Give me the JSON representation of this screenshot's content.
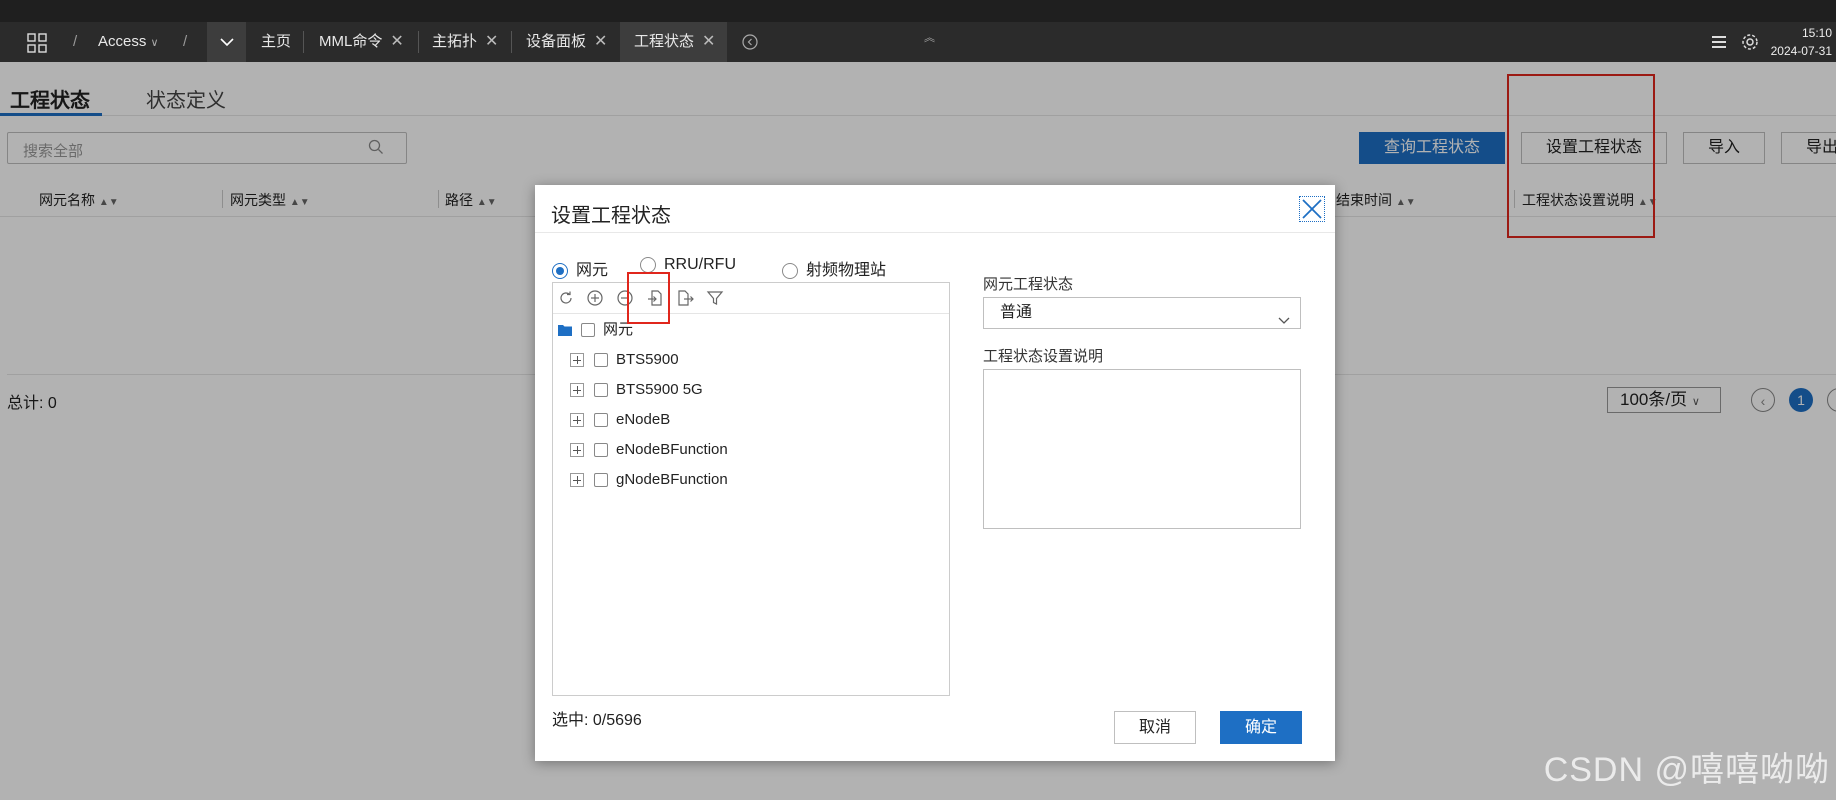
{
  "topbar": {
    "breadcrumb_app": "Access",
    "tabs": [
      {
        "label": "主页",
        "closable": false,
        "active": false
      },
      {
        "label": "MML命令",
        "closable": true,
        "active": false
      },
      {
        "label": "主拓扑",
        "closable": true,
        "active": false
      },
      {
        "label": "设备面板",
        "closable": true,
        "active": false
      },
      {
        "label": "工程状态",
        "closable": true,
        "active": true
      }
    ],
    "time": "15:10",
    "date": "2024-07-31"
  },
  "page": {
    "subtabs": [
      "工程状态",
      "状态定义"
    ],
    "search_placeholder": "搜索全部",
    "buttons": {
      "query": "查询工程状态",
      "set": "设置工程状态",
      "import": "导入",
      "export": "导出"
    },
    "columns": [
      "网元名称",
      "网元类型",
      "路径",
      "结束时间",
      "工程状态设置说明"
    ],
    "total": "总计: 0",
    "page_size": "100条/页",
    "current_page": "1"
  },
  "modal": {
    "title": "设置工程状态",
    "radios": [
      "网元",
      "RRU/RFU",
      "射频物理站"
    ],
    "selected_radio": "网元",
    "tree_root": "网元",
    "tree_nodes": [
      "BTS5900",
      "BTS5900 5G",
      "eNodeB",
      "eNodeBFunction",
      "gNodeBFunction"
    ],
    "selected_count": "选中: 0/5696",
    "status_label": "网元工程状态",
    "status_value": "普通",
    "desc_label": "工程状态设置说明",
    "desc_value": "",
    "cancel": "取消",
    "confirm": "确定"
  },
  "watermark": "CSDN @嘻嘻呦呦",
  "colors": {
    "accent": "#1e6fc4",
    "highlight_box": "#e0261c"
  }
}
